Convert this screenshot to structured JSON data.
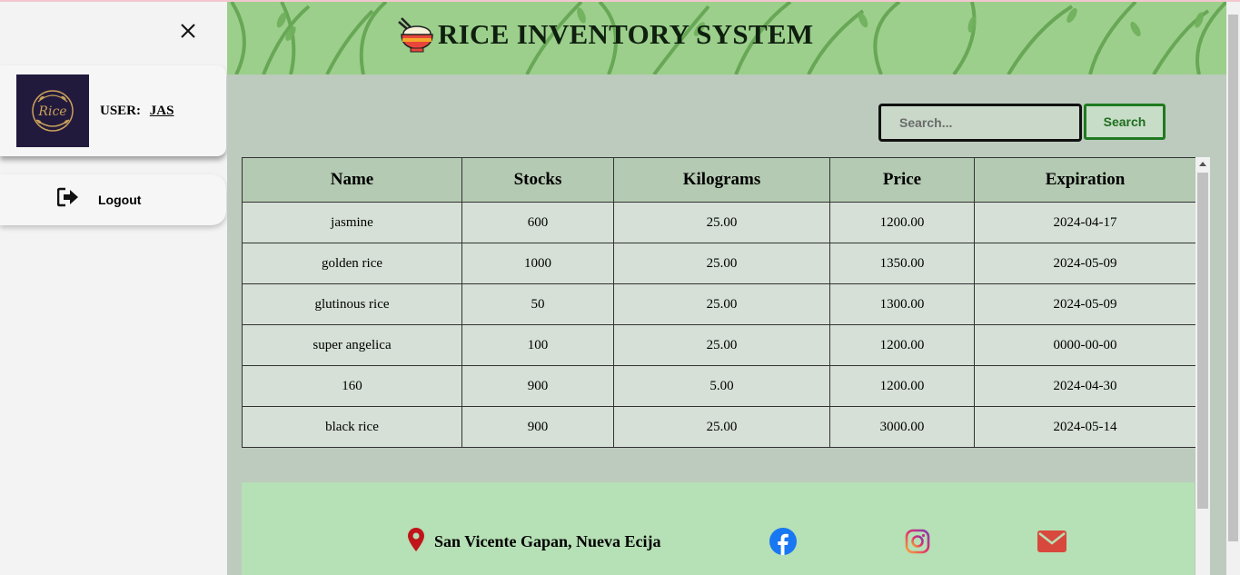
{
  "sidebar": {
    "user_label": "USER:",
    "user_name": "JAS",
    "avatar_text": "Rice",
    "logout_label": "Logout"
  },
  "header": {
    "title": "RICE INVENTORY SYSTEM"
  },
  "search": {
    "placeholder": "Search...",
    "value": "",
    "button_label": "Search"
  },
  "table": {
    "columns": [
      "Name",
      "Stocks",
      "Kilograms",
      "Price",
      "Expiration"
    ],
    "rows": [
      [
        "jasmine",
        "600",
        "25.00",
        "1200.00",
        "2024-04-17"
      ],
      [
        "golden rice",
        "1000",
        "25.00",
        "1350.00",
        "2024-05-09"
      ],
      [
        "glutinous rice",
        "50",
        "25.00",
        "1300.00",
        "2024-05-09"
      ],
      [
        "super angelica",
        "100",
        "25.00",
        "1200.00",
        "0000-00-00"
      ],
      [
        "160",
        "900",
        "5.00",
        "1200.00",
        "2024-04-30"
      ],
      [
        "black rice",
        "900",
        "25.00",
        "3000.00",
        "2024-05-14"
      ]
    ]
  },
  "footer": {
    "address": "San Vicente Gapan, Nueva Ecija"
  },
  "icons": {
    "close": "close-icon",
    "logout": "logout-icon",
    "logo": "rice-bowl-icon",
    "location": "location-pin-icon",
    "facebook": "facebook-icon",
    "instagram": "instagram-icon",
    "email": "email-icon"
  },
  "colors": {
    "banner": "#9ccf8c",
    "main_bg": "#bccbbd",
    "table_header": "#b4cab2",
    "table_cell": "#d6e0d6",
    "footer_bg": "#b6e0b5",
    "search_button_accent": "#1f7a1f",
    "facebook": "#1877f2",
    "location_pin": "#c0151b",
    "email": "#d8483c"
  }
}
